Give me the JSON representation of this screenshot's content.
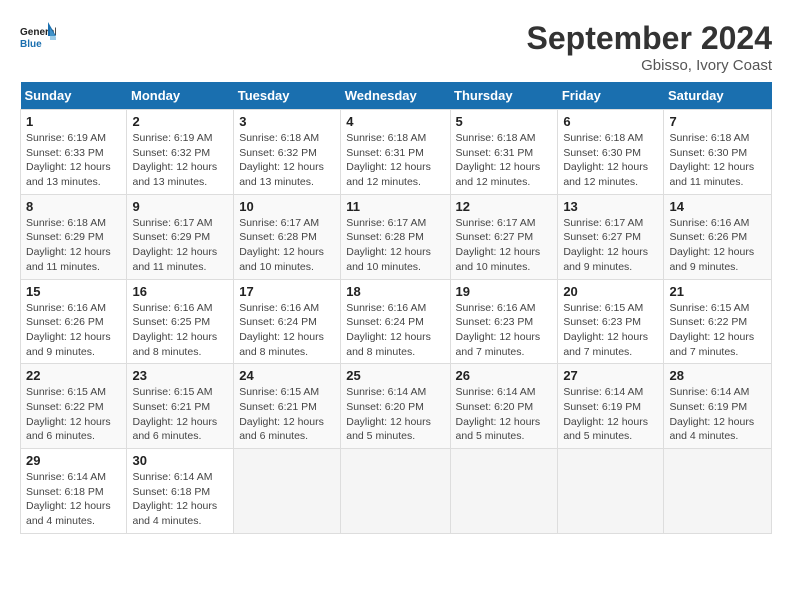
{
  "header": {
    "logo_line1": "General",
    "logo_line2": "Blue",
    "month_title": "September 2024",
    "subtitle": "Gbisso, Ivory Coast"
  },
  "days_of_week": [
    "Sunday",
    "Monday",
    "Tuesday",
    "Wednesday",
    "Thursday",
    "Friday",
    "Saturday"
  ],
  "weeks": [
    [
      {
        "day": "1",
        "info": "Sunrise: 6:19 AM\nSunset: 6:33 PM\nDaylight: 12 hours and 13 minutes."
      },
      {
        "day": "2",
        "info": "Sunrise: 6:19 AM\nSunset: 6:32 PM\nDaylight: 12 hours and 13 minutes."
      },
      {
        "day": "3",
        "info": "Sunrise: 6:18 AM\nSunset: 6:32 PM\nDaylight: 12 hours and 13 minutes."
      },
      {
        "day": "4",
        "info": "Sunrise: 6:18 AM\nSunset: 6:31 PM\nDaylight: 12 hours and 12 minutes."
      },
      {
        "day": "5",
        "info": "Sunrise: 6:18 AM\nSunset: 6:31 PM\nDaylight: 12 hours and 12 minutes."
      },
      {
        "day": "6",
        "info": "Sunrise: 6:18 AM\nSunset: 6:30 PM\nDaylight: 12 hours and 12 minutes."
      },
      {
        "day": "7",
        "info": "Sunrise: 6:18 AM\nSunset: 6:30 PM\nDaylight: 12 hours and 11 minutes."
      }
    ],
    [
      {
        "day": "8",
        "info": "Sunrise: 6:18 AM\nSunset: 6:29 PM\nDaylight: 12 hours and 11 minutes."
      },
      {
        "day": "9",
        "info": "Sunrise: 6:17 AM\nSunset: 6:29 PM\nDaylight: 12 hours and 11 minutes."
      },
      {
        "day": "10",
        "info": "Sunrise: 6:17 AM\nSunset: 6:28 PM\nDaylight: 12 hours and 10 minutes."
      },
      {
        "day": "11",
        "info": "Sunrise: 6:17 AM\nSunset: 6:28 PM\nDaylight: 12 hours and 10 minutes."
      },
      {
        "day": "12",
        "info": "Sunrise: 6:17 AM\nSunset: 6:27 PM\nDaylight: 12 hours and 10 minutes."
      },
      {
        "day": "13",
        "info": "Sunrise: 6:17 AM\nSunset: 6:27 PM\nDaylight: 12 hours and 9 minutes."
      },
      {
        "day": "14",
        "info": "Sunrise: 6:16 AM\nSunset: 6:26 PM\nDaylight: 12 hours and 9 minutes."
      }
    ],
    [
      {
        "day": "15",
        "info": "Sunrise: 6:16 AM\nSunset: 6:26 PM\nDaylight: 12 hours and 9 minutes."
      },
      {
        "day": "16",
        "info": "Sunrise: 6:16 AM\nSunset: 6:25 PM\nDaylight: 12 hours and 8 minutes."
      },
      {
        "day": "17",
        "info": "Sunrise: 6:16 AM\nSunset: 6:24 PM\nDaylight: 12 hours and 8 minutes."
      },
      {
        "day": "18",
        "info": "Sunrise: 6:16 AM\nSunset: 6:24 PM\nDaylight: 12 hours and 8 minutes."
      },
      {
        "day": "19",
        "info": "Sunrise: 6:16 AM\nSunset: 6:23 PM\nDaylight: 12 hours and 7 minutes."
      },
      {
        "day": "20",
        "info": "Sunrise: 6:15 AM\nSunset: 6:23 PM\nDaylight: 12 hours and 7 minutes."
      },
      {
        "day": "21",
        "info": "Sunrise: 6:15 AM\nSunset: 6:22 PM\nDaylight: 12 hours and 7 minutes."
      }
    ],
    [
      {
        "day": "22",
        "info": "Sunrise: 6:15 AM\nSunset: 6:22 PM\nDaylight: 12 hours and 6 minutes."
      },
      {
        "day": "23",
        "info": "Sunrise: 6:15 AM\nSunset: 6:21 PM\nDaylight: 12 hours and 6 minutes."
      },
      {
        "day": "24",
        "info": "Sunrise: 6:15 AM\nSunset: 6:21 PM\nDaylight: 12 hours and 6 minutes."
      },
      {
        "day": "25",
        "info": "Sunrise: 6:14 AM\nSunset: 6:20 PM\nDaylight: 12 hours and 5 minutes."
      },
      {
        "day": "26",
        "info": "Sunrise: 6:14 AM\nSunset: 6:20 PM\nDaylight: 12 hours and 5 minutes."
      },
      {
        "day": "27",
        "info": "Sunrise: 6:14 AM\nSunset: 6:19 PM\nDaylight: 12 hours and 5 minutes."
      },
      {
        "day": "28",
        "info": "Sunrise: 6:14 AM\nSunset: 6:19 PM\nDaylight: 12 hours and 4 minutes."
      }
    ],
    [
      {
        "day": "29",
        "info": "Sunrise: 6:14 AM\nSunset: 6:18 PM\nDaylight: 12 hours and 4 minutes."
      },
      {
        "day": "30",
        "info": "Sunrise: 6:14 AM\nSunset: 6:18 PM\nDaylight: 12 hours and 4 minutes."
      },
      null,
      null,
      null,
      null,
      null
    ]
  ]
}
